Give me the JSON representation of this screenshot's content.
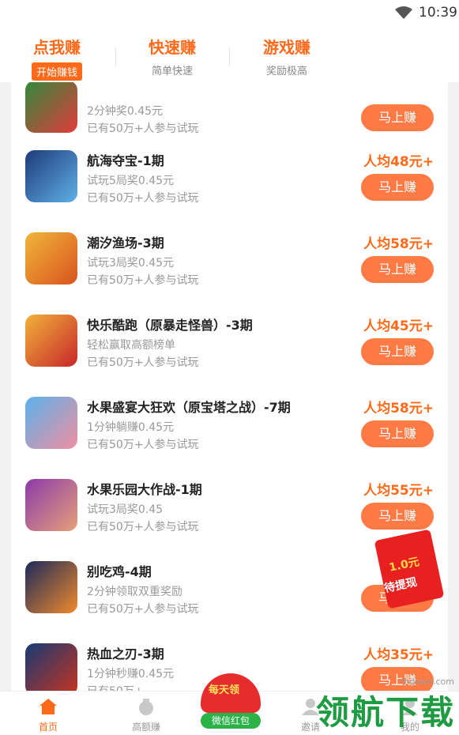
{
  "status_bar": {
    "time": "10:39",
    "wifi_icon": "wifi-icon"
  },
  "top_tabs": [
    {
      "title": "点我赚",
      "subtitle": "开始赚钱"
    },
    {
      "title": "快速赚",
      "subtitle": "简单快速"
    },
    {
      "title": "游戏赚",
      "subtitle": "奖励极高"
    }
  ],
  "items": [
    {
      "name": "",
      "line1": "2分钟奖0.45元",
      "line2": "已有50万+人参与试玩",
      "reward": "",
      "button": "马上赚",
      "icon": "dragon-game-icon"
    },
    {
      "name": "航海夺宝-1期",
      "line1": "试玩5局奖0.45元",
      "line2": "已有50万+人参与试玩",
      "reward": "人均48元+",
      "button": "马上赚",
      "icon": "shark-pirate-game-icon"
    },
    {
      "name": "潮汐渔场-3期",
      "line1": "试玩3局奖0.45元",
      "line2": "已有50万+人参与试玩",
      "reward": "人均58元+",
      "button": "马上赚",
      "icon": "crab-fishing-game-icon"
    },
    {
      "name": "快乐酷跑（原暴走怪兽）-3期",
      "line1": "轻松赢取高额榜单",
      "line2": "已有50万+人参与试玩",
      "reward": "人均45元+",
      "button": "马上赚",
      "icon": "red-monster-game-icon"
    },
    {
      "name": "水果盛宴大狂欢（原宝塔之战）-7期",
      "line1": "1分钟躺赚0.45元",
      "line2": "已有50万+人参与试玩",
      "reward": "人均58元+",
      "button": "马上赚",
      "icon": "pig-coin-game-icon"
    },
    {
      "name": "水果乐园大作战-1期",
      "line1": "试玩3局奖0.45",
      "line2": "已有50万+人参与试玩",
      "reward": "人均55元+",
      "button": "马上赚",
      "icon": "girl-portrait-game-icon"
    },
    {
      "name": "别吃鸡-4期",
      "line1": "2分钟领取双重奖励",
      "line2": "已有50万+人参与试玩",
      "reward": "人",
      "button": "马上赚",
      "icon": "penguin-game-icon"
    },
    {
      "name": "热血之刃-3期",
      "line1": "1分钟秒赚0.45元",
      "line2": "已有50万+",
      "reward": "人均35元+",
      "button": "马上赚",
      "icon": "dragon-warrior-game-icon"
    }
  ],
  "red_packet": {
    "amount": "1.0元",
    "label": "待提现",
    "icon": "red-envelope-icon"
  },
  "bottom_nav": [
    {
      "label": "首页",
      "icon": "home-icon"
    },
    {
      "label": "高额赚",
      "icon": "money-bag-icon"
    },
    {
      "label": "邀请",
      "icon": "user-icon"
    },
    {
      "label": "我的",
      "icon": "profile-icon"
    }
  ],
  "wechat_promo": {
    "top_text": "每天领",
    "pill_text": "微信红包"
  },
  "watermark": {
    "url": "lhdown.com",
    "text": "领航下载"
  },
  "colors": {
    "accent": "#ff6a1a",
    "button": "#ff7a45",
    "green": "#1f9b43"
  }
}
